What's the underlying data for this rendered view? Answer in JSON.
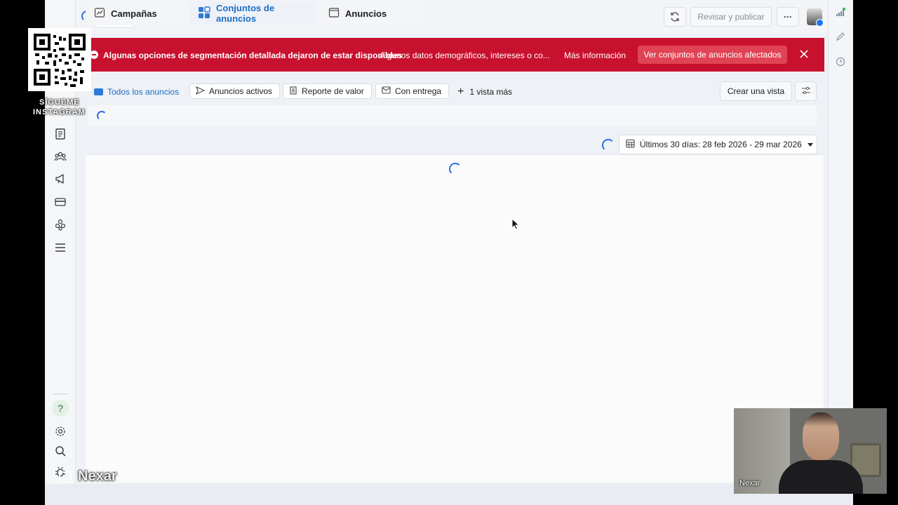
{
  "topbar": {
    "review_publish": "Revisar y publicar",
    "more": "···"
  },
  "banner": {
    "title": "Algunas opciones de segmentación detallada dejaron de estar disponibles",
    "detail": "Algunos datos demográficos, intereses o co...",
    "more_info": "Más información",
    "view_affected": "Ver conjuntos de anuncios afectados"
  },
  "views": {
    "all_ads": "Todos los anuncios",
    "active_ads": "Anuncios activos",
    "value_report": "Reporte de valor",
    "with_delivery": "Con entrega",
    "more_views": "1 vista más",
    "create_view": "Crear una vista"
  },
  "tabs": {
    "campaigns": "Campañas",
    "ad_sets": "Conjuntos de anuncios",
    "ads": "Anuncios"
  },
  "date_range": "Últimos 30 días: 28 feb 2026 - 29 mar 2026",
  "overlay": {
    "follow": "SÍGUEME",
    "instagram": "INSTAGRAM",
    "watermark": "Nexar",
    "cam_name": "Nexar"
  },
  "colors": {
    "banner": "#c8112e",
    "accent": "#1e6ec2",
    "meta_blue": "#0668e1"
  },
  "icons": {
    "meta_logo": "meta-logo-icon",
    "refresh": "refresh-icon",
    "close": "close-icon",
    "calendar": "calendar-icon",
    "help": "help-icon",
    "settings": "gear-icon",
    "search": "search-icon",
    "bug": "bug-icon"
  }
}
